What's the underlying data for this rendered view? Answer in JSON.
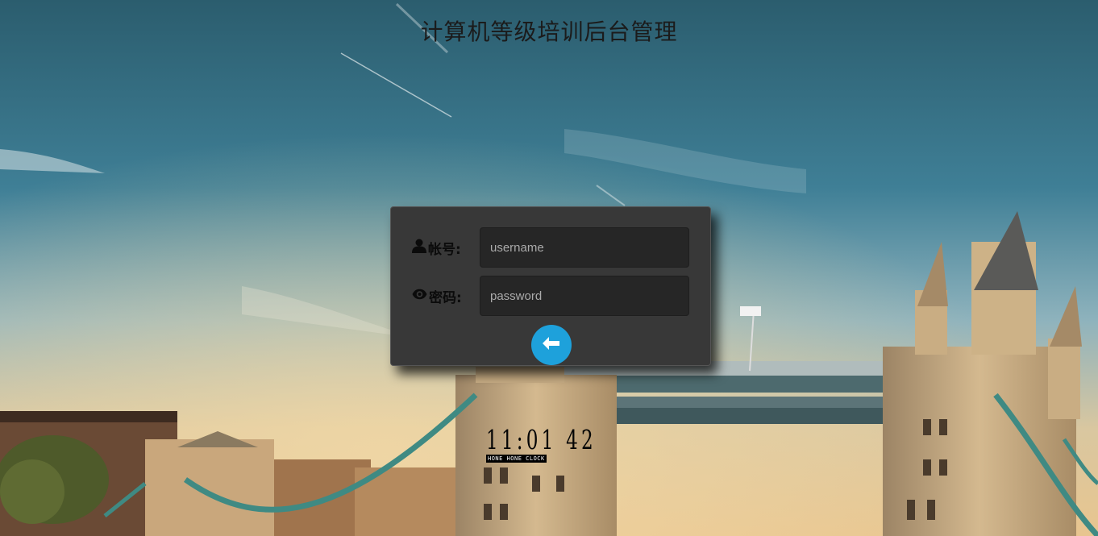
{
  "page": {
    "title": "计算机等级培训后台管理"
  },
  "login": {
    "username_label": "帐号:",
    "username_placeholder": "username",
    "password_label": "密码:",
    "password_placeholder": "password"
  },
  "clock": {
    "time": "11:01 42",
    "caption": "HONE HONE CLOCK"
  },
  "icons": {
    "user": "user-icon",
    "password": "eye-icon",
    "submit": "arrow-left-icon"
  },
  "colors": {
    "accent": "#1ea1db",
    "panel": "#383838",
    "input": "#262626"
  }
}
